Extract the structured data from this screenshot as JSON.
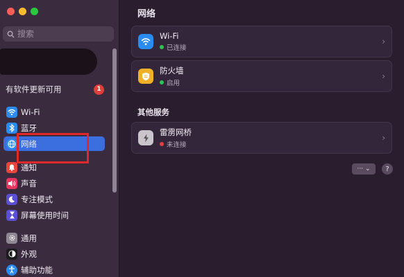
{
  "sidebar": {
    "search_placeholder": "搜索",
    "update_label": "有软件更新可用",
    "update_count": "1",
    "items": [
      {
        "label": "Wi-Fi",
        "icon": "wifi-icon"
      },
      {
        "label": "蓝牙",
        "icon": "bluetooth-icon"
      },
      {
        "label": "网络",
        "icon": "network-globe-icon"
      },
      {
        "label": "通知",
        "icon": "bell-icon"
      },
      {
        "label": "声音",
        "icon": "speaker-icon"
      },
      {
        "label": "专注模式",
        "icon": "moon-icon"
      },
      {
        "label": "屏幕使用时间",
        "icon": "hourglass-icon"
      },
      {
        "label": "通用",
        "icon": "gear-icon"
      },
      {
        "label": "外观",
        "icon": "appearance-icon"
      },
      {
        "label": "辅助功能",
        "icon": "accessibility-icon"
      }
    ]
  },
  "main": {
    "title": "网络",
    "services": [
      {
        "name": "Wi-Fi",
        "status": "已连接",
        "status_color": "#2fc552",
        "icon": "wifi-icon",
        "icon_bg": "#2a8cf0"
      },
      {
        "name": "防火墙",
        "status": "启用",
        "status_color": "#2fc552",
        "icon": "firewall-shield-icon",
        "icon_bg": "#f0b128"
      }
    ],
    "other_title": "其他服务",
    "other_services": [
      {
        "name": "雷雳网桥",
        "status": "未连接",
        "status_color": "#e0403c",
        "icon": "thunderbolt-icon",
        "icon_bg": "#c9c5cb"
      }
    ],
    "more_label": "··· ⌄",
    "help_label": "?"
  },
  "colors": {
    "accent": "#3b6fe0",
    "highlight_box": "#e02828"
  }
}
